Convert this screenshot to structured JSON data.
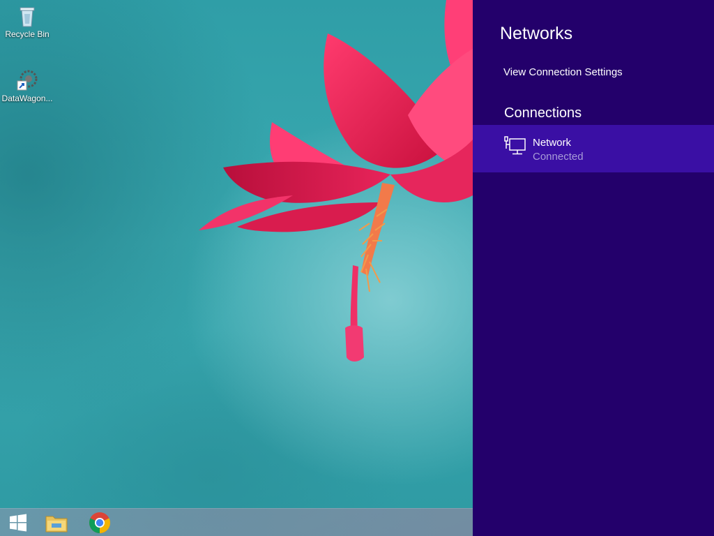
{
  "desktop": {
    "icons": [
      {
        "label": "Recycle Bin",
        "icon": "recycle-bin-icon"
      },
      {
        "label": "DataWagon...",
        "icon": "datawagon-shortcut-icon"
      }
    ]
  },
  "taskbar": {
    "items": [
      {
        "name": "start",
        "icon": "windows-logo-icon"
      },
      {
        "name": "file-explorer",
        "icon": "folder-icon"
      },
      {
        "name": "chrome",
        "icon": "chrome-icon"
      }
    ]
  },
  "networks_pane": {
    "title": "Networks",
    "view_settings_label": "View Connection Settings",
    "connections_heading": "Connections",
    "connections": [
      {
        "name": "Network",
        "status": "Connected",
        "icon": "wired-network-icon"
      }
    ],
    "colors": {
      "background": "#23006b",
      "selected_row": "#3a0fa4",
      "secondary_text": "#a89cd8"
    }
  }
}
